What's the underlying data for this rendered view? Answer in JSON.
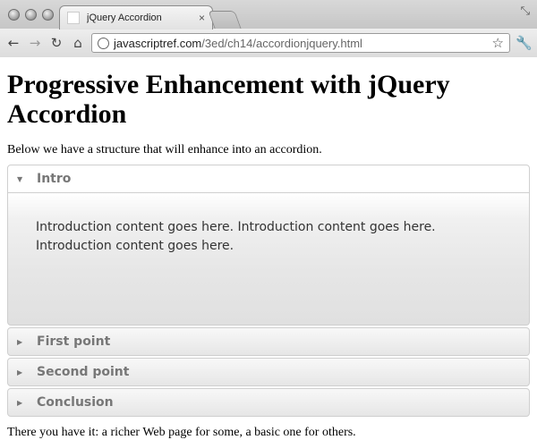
{
  "browser": {
    "tab_title": "jQuery Accordion",
    "tab_close": "×",
    "url_host": "javascriptref.com",
    "url_path": "/3ed/ch14/accordionjquery.html",
    "icons": [
      "back-icon",
      "forward-icon",
      "reload-icon",
      "home-icon",
      "globe-icon",
      "star-icon",
      "wrench-icon"
    ]
  },
  "page": {
    "heading": "Progressive Enhancement with jQuery Accordion",
    "intro": "Below we have a structure that will enhance into an accordion.",
    "footer": "There you have it: a richer Web page for some, a basic one for others."
  },
  "accordion": {
    "sections": [
      {
        "label": "Intro",
        "expanded": true,
        "content": "Introduction content goes here. Introduction content goes here. Introduction content goes here."
      },
      {
        "label": "First point",
        "expanded": false
      },
      {
        "label": "Second point",
        "expanded": false
      },
      {
        "label": "Conclusion",
        "expanded": false
      }
    ]
  },
  "colors": {
    "header_text": "#777777",
    "panel_bg": "#e6e6e6"
  }
}
